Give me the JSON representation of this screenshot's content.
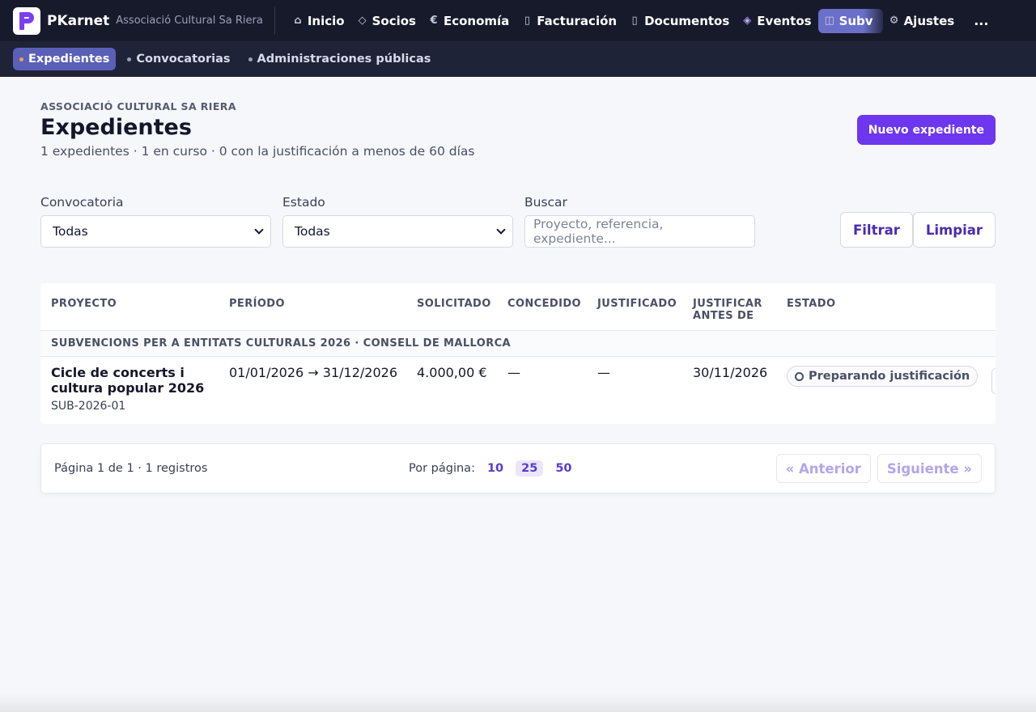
{
  "app": {
    "brand": "PKarnet",
    "org": "Associació Cultural Sa Riera"
  },
  "nav": {
    "items": [
      {
        "label": "Inicio",
        "icon": "⌂"
      },
      {
        "label": "Socios",
        "icon": "◇"
      },
      {
        "label": "Economía",
        "icon": "€"
      },
      {
        "label": "Facturación",
        "icon": "▯"
      },
      {
        "label": "Documentos",
        "icon": "▯"
      },
      {
        "label": "Eventos",
        "icon": "◈"
      },
      {
        "label": "Subv",
        "icon": "◫"
      },
      {
        "label": "Ajustes",
        "icon": "⚙"
      }
    ],
    "more": "..."
  },
  "subnav": {
    "items": [
      {
        "label": "Expedientes"
      },
      {
        "label": "Convocatorias"
      },
      {
        "label": "Administraciones públicas"
      }
    ]
  },
  "page": {
    "eyebrow": "ASSOCIACIÓ CULTURAL SA RIERA",
    "title": "Expedientes",
    "summary": "1 expedientes · 1 en curso · 0 con la justificación a menos de 60 días",
    "new_button": "Nuevo expediente"
  },
  "filters": {
    "convocatoria_label": "Convocatoria",
    "convocatoria_value": "Todas",
    "estado_label": "Estado",
    "estado_value": "Todas",
    "buscar_label": "Buscar",
    "buscar_placeholder": "Proyecto, referencia, expediente...",
    "filtrar": "Filtrar",
    "limpiar": "Limpiar"
  },
  "table": {
    "headers": [
      "PROYECTO",
      "PERÍODO",
      "SOLICITADO",
      "CONCEDIDO",
      "JUSTIFICADO",
      "JUSTIFICAR ANTES DE",
      "ESTADO"
    ],
    "group": "SUBVENCIONS PER A ENTITATS CULTURALS 2026 · CONSELL DE MALLORCA",
    "rows": [
      {
        "project": "Cicle de concerts i cultura popular 2026",
        "ref": "SUB-2026-01",
        "period": "01/01/2026 → 31/12/2026",
        "requested": "4.000,00 €",
        "granted": "—",
        "justified": "—",
        "deadline": "30/11/2026",
        "status": "Preparando justificación"
      }
    ]
  },
  "pager": {
    "info": "Página 1 de 1 · 1 registros",
    "per_page_label": "Por página:",
    "sizes": [
      "10",
      "25",
      "50"
    ],
    "prev": "« Anterior",
    "next": "Siguiente »"
  }
}
